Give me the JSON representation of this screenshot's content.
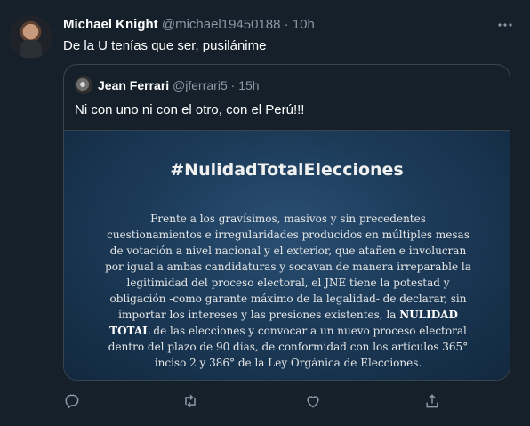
{
  "tweet": {
    "author_name": "Michael Knight",
    "handle": "@michael19450188",
    "separator": "·",
    "time": "10h",
    "text": "De la U tenías que ser, pusilánime",
    "more_icon": "more-icon"
  },
  "quote": {
    "author_name": "Jean Ferrari",
    "handle": "@jferrari5",
    "separator": "·",
    "time": "15h",
    "text": "Ni con uno ni con el otro, con el Perú!!!",
    "image": {
      "hashtag": "#NulidadTotalElecciones",
      "paragraph_before": "Frente a los gravísimos, masivos y sin precedentes cuestionamientos e irregularidades producidos en múltiples mesas de votación a nivel nacional y el exterior, que atañen e involucran por igual a ambas candidaturas y socavan de manera irreparable la legitimidad del proceso electoral, el JNE tiene la potestad y obligación -como garante máximo de la legalidad- de declarar, sin importar los intereses y las presiones existentes, la ",
      "paragraph_bold": "NULIDAD TOTAL",
      "paragraph_after": " de las elecciones y convocar a un nuevo proceso electoral dentro del plazo de 90 días, de conformidad con los artículos 365° inciso 2 y 386° de la Ley Orgánica de Elecciones."
    }
  },
  "actions": [
    "reply-icon",
    "retweet-icon",
    "like-icon",
    "share-icon"
  ],
  "colors": {
    "background": "#15202b",
    "text_primary": "#ffffff",
    "text_secondary": "#8b98a5",
    "border": "#38444d"
  }
}
